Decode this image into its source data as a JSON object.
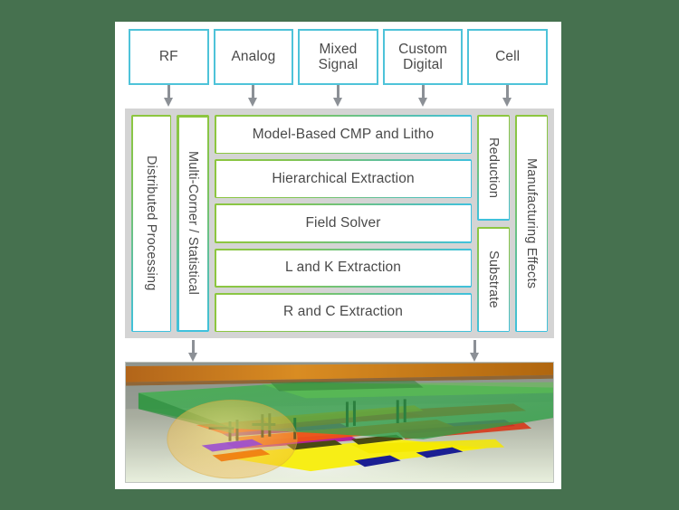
{
  "diagram": {
    "title": "Parasitic Extraction Platform Flow Diagram",
    "background_color": "#46714f",
    "card_color": "#ffffff",
    "panel_color": "#d4d4d4",
    "accent_cyan": "#4ec3d9",
    "accent_green": "#8dc63f",
    "arrow_color": "#8c9096"
  },
  "applications": {
    "boxes": [
      {
        "label": "RF"
      },
      {
        "label": "Analog"
      },
      {
        "label": "Mixed\nSignal"
      },
      {
        "label": "Custom\nDigital"
      },
      {
        "label": "Cell"
      }
    ]
  },
  "engine_panel": {
    "left_columns": [
      {
        "label": "Distributed Processing"
      },
      {
        "label": "Multi-Corner / Statistical"
      }
    ],
    "center_boxes": [
      {
        "label": "Model-Based CMP and Litho"
      },
      {
        "label": "Hierarchical Extraction"
      },
      {
        "label": "Field Solver"
      },
      {
        "label": "L and K Extraction"
      },
      {
        "label": "R and C Extraction"
      }
    ],
    "right_stack": [
      {
        "label": "Reduction"
      },
      {
        "label": "Substrate"
      }
    ],
    "right_columns": [
      {
        "label": "Manufacturing Effects"
      }
    ]
  },
  "arrows": {
    "top_count": 5,
    "bottom_count": 2,
    "direction": "down"
  },
  "render": {
    "caption": "3D parasitic extraction visualization",
    "description": "Layered semiconductor interconnect stack with transparent green field-solver surface, orange substrate, yellow metal plane, purple and red routing layers, dark blue pads and black vias"
  }
}
